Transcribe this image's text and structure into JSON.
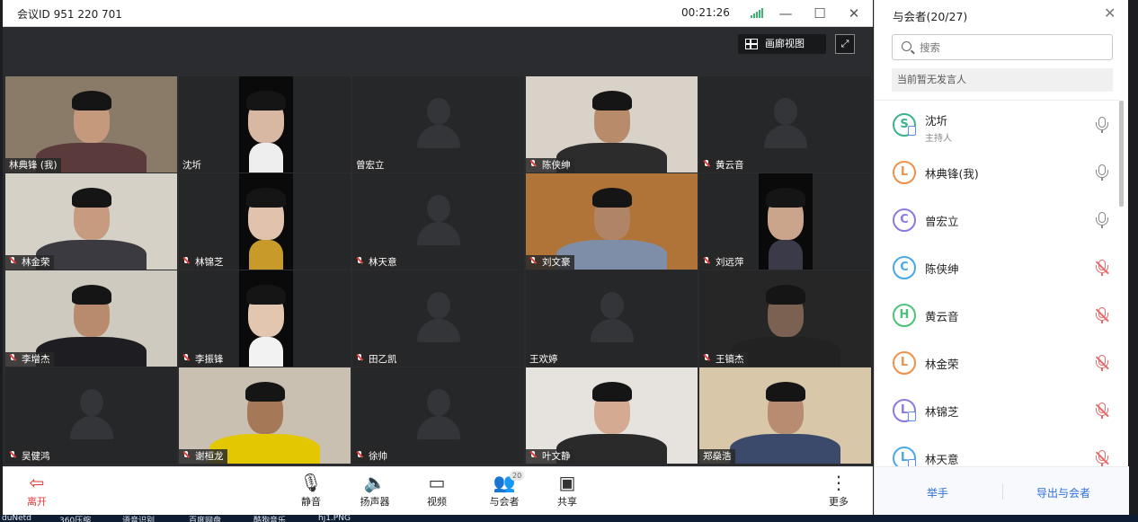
{
  "window": {
    "meeting_id": "会议ID 951 220 701",
    "timer": "00:21:26"
  },
  "view": {
    "gallery_label": "画廊视图"
  },
  "tiles": [
    {
      "name": "林典锋 (我)",
      "mic": false,
      "video": true,
      "bg": "#8a7a68",
      "skin": "#c59a7c",
      "shirt": "#5a3a3a"
    },
    {
      "name": "沈圻",
      "mic": false,
      "video": true,
      "bg": "#0a0a0a",
      "skin": "#d9b8a3",
      "shirt": "#eeeeee"
    },
    {
      "name": "曾宏立",
      "mic": false,
      "video": false
    },
    {
      "name": "陈侠绅",
      "mic": true,
      "video": true,
      "bg": "#d9d2c8",
      "skin": "#b88c6b",
      "shirt": "#2c2c2c"
    },
    {
      "name": "黄云音",
      "mic": true,
      "video": false
    },
    {
      "name": "林金荣",
      "mic": true,
      "video": true,
      "bg": "#d6d1c7",
      "skin": "#c69b80",
      "shirt": "#3a3a40"
    },
    {
      "name": "林锦芝",
      "mic": true,
      "video": true,
      "bg": "#0a0a0a",
      "skin": "#e0c2ad",
      "shirt": "#c89a2a"
    },
    {
      "name": "林天意",
      "mic": true,
      "video": false
    },
    {
      "name": "刘文豪",
      "mic": true,
      "video": true,
      "bg": "#b07438",
      "skin": "#b08466",
      "shirt": "#7f8ea8"
    },
    {
      "name": "刘远萍",
      "mic": true,
      "video": true,
      "bg": "#0a0a0a",
      "skin": "#caa58c",
      "shirt": "#3a3a48"
    },
    {
      "name": "李增杰",
      "mic": true,
      "video": true,
      "bg": "#cfcabf",
      "skin": "#b88b6e",
      "shirt": "#1d1d22"
    },
    {
      "name": "李振锋",
      "mic": true,
      "video": true,
      "bg": "#0a0a0a",
      "skin": "#e3c6b0",
      "shirt": "#f2f2f2"
    },
    {
      "name": "田乙凯",
      "mic": true,
      "video": false
    },
    {
      "name": "王欢婷",
      "mic": false,
      "video": false
    },
    {
      "name": "王镐杰",
      "mic": true,
      "video": true,
      "bg": "#262626",
      "skin": "#7a6152",
      "shirt": "#222"
    },
    {
      "name": "吴健鸿",
      "mic": true,
      "video": false
    },
    {
      "name": "谢桓龙",
      "mic": true,
      "video": true,
      "bg": "#c9c0b2",
      "skin": "#a57858",
      "shirt": "#e3c700"
    },
    {
      "name": "徐帅",
      "mic": true,
      "video": false
    },
    {
      "name": "叶文静",
      "mic": true,
      "video": true,
      "bg": "#e6e2de",
      "skin": "#d4ab92",
      "shirt": "#2a2a2a"
    },
    {
      "name": "郑燊浩",
      "mic": false,
      "video": true,
      "bg": "#d8c7a8",
      "skin": "#b88c70",
      "shirt": "#3b4a6a"
    }
  ],
  "toolbar": {
    "leave": "离开",
    "mute": "静音",
    "speaker": "扬声器",
    "video": "视频",
    "participants": "与会者",
    "participants_badge": "20",
    "share": "共享",
    "more": "更多"
  },
  "panel": {
    "title": "与会者(20/27)",
    "search_placeholder": "搜索",
    "no_speaker": "当前暂无发言人",
    "people": [
      {
        "initial": "S",
        "name": "沈圻",
        "role": "主持人",
        "color": "#3cb38a",
        "device": true,
        "muted": false
      },
      {
        "initial": "L",
        "name": "林典锋(我)",
        "role": "",
        "color": "#f0904a",
        "device": false,
        "muted": false
      },
      {
        "initial": "C",
        "name": "曾宏立",
        "role": "",
        "color": "#8a7ae0",
        "device": false,
        "muted": false
      },
      {
        "initial": "C",
        "name": "陈侠绅",
        "role": "",
        "color": "#4aa8e8",
        "device": false,
        "muted": true
      },
      {
        "initial": "H",
        "name": "黄云音",
        "role": "",
        "color": "#4cc27a",
        "device": false,
        "muted": true
      },
      {
        "initial": "L",
        "name": "林金荣",
        "role": "",
        "color": "#f0904a",
        "device": false,
        "muted": true
      },
      {
        "initial": "L",
        "name": "林锦芝",
        "role": "",
        "color": "#8a7ae0",
        "device": true,
        "muted": true
      },
      {
        "initial": "L",
        "name": "林天意",
        "role": "",
        "color": "#4aa8e8",
        "device": true,
        "muted": true
      }
    ],
    "raise_hand": "举手",
    "export": "导出与会者"
  },
  "taskbar": [
    "duNetd",
    "360压缩",
    "语音识别",
    "百度网盘",
    "酷狗音乐",
    "hj1.PNG"
  ]
}
